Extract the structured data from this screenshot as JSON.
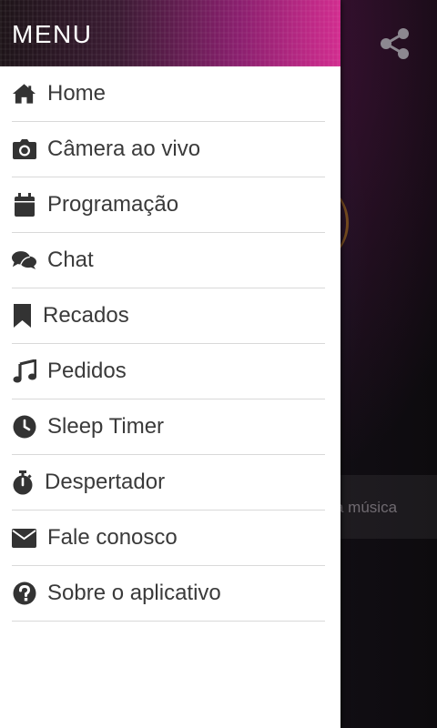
{
  "drawer": {
    "title": "MENU",
    "items": [
      {
        "label": "Home",
        "icon": "home-icon"
      },
      {
        "label": "Câmera ao vivo",
        "icon": "camera-icon"
      },
      {
        "label": "Programação",
        "icon": "calendar-icon"
      },
      {
        "label": "Chat",
        "icon": "chat-icon"
      },
      {
        "label": "Recados",
        "icon": "bookmark-icon"
      },
      {
        "label": "Pedidos",
        "icon": "music-icon"
      },
      {
        "label": "Sleep Timer",
        "icon": "clock-icon"
      },
      {
        "label": "Despertador",
        "icon": "stopwatch-icon"
      },
      {
        "label": "Fale conosco",
        "icon": "envelope-icon"
      },
      {
        "label": "Sobre o aplicativo",
        "icon": "question-icon"
      }
    ]
  },
  "background": {
    "partial_text": "a música",
    "share_icon": "share-icon"
  },
  "colors": {
    "header_gradient_end": "#d22c8f",
    "text": "#3a3a3a",
    "divider": "#d9d9d9"
  }
}
